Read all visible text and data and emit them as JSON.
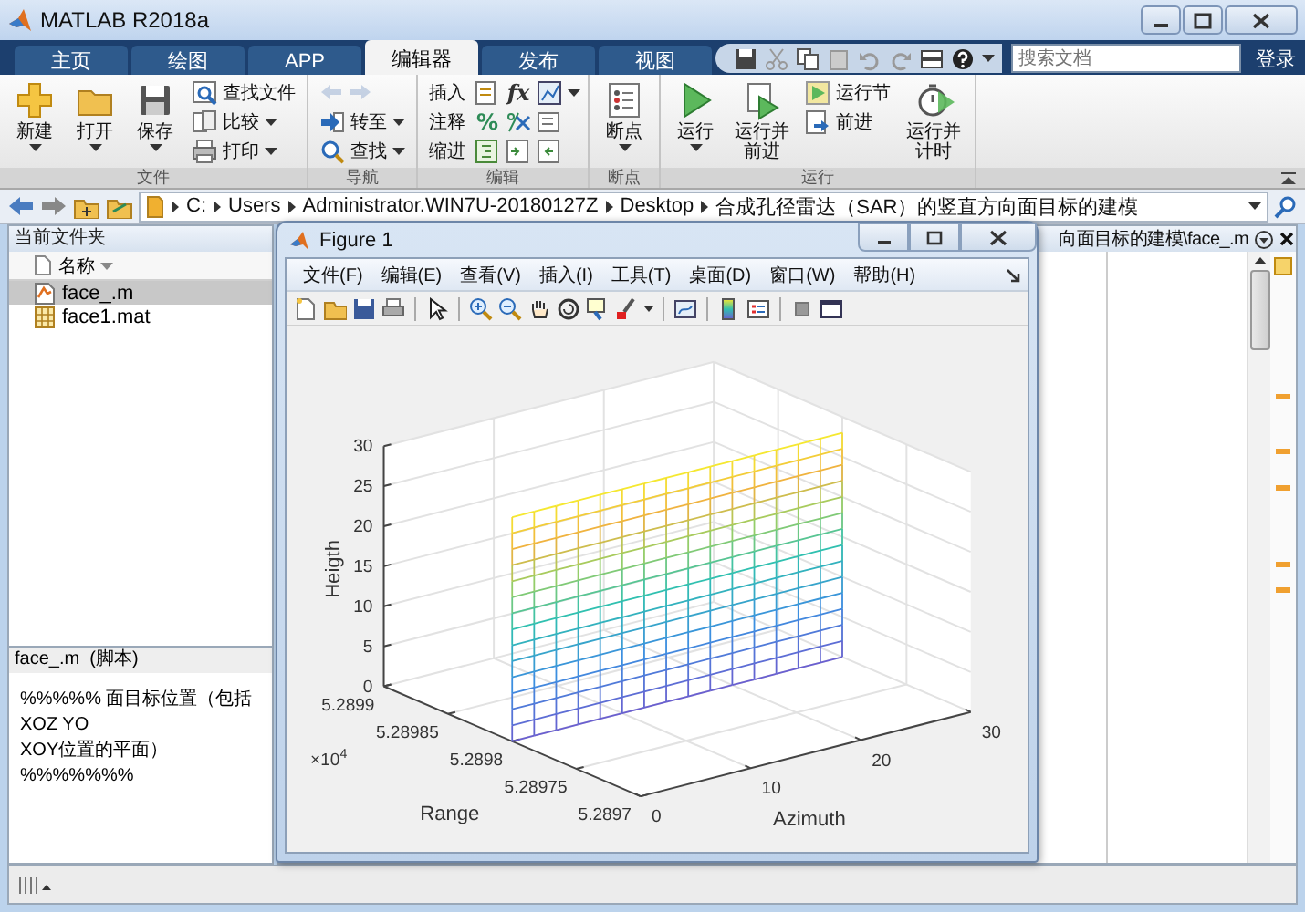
{
  "window": {
    "title": "MATLAB R2018a"
  },
  "tabs": [
    {
      "label": "主页",
      "selected": false
    },
    {
      "label": "绘图",
      "selected": false
    },
    {
      "label": "APP",
      "selected": false
    },
    {
      "label": "编辑器",
      "selected": true
    },
    {
      "label": "发布",
      "selected": false
    },
    {
      "label": "视图",
      "selected": false
    }
  ],
  "search": {
    "placeholder": "搜索文档"
  },
  "sign_in": "登录",
  "ribbon_groups": [
    {
      "title": "文件",
      "items": [
        {
          "kind": "large",
          "label": "新建",
          "has_menu": true
        },
        {
          "kind": "large",
          "label": "打开",
          "has_menu": true
        },
        {
          "kind": "large",
          "label": "保存",
          "has_menu": true
        },
        {
          "kind": "stack",
          "rows": [
            {
              "label": "查找文件",
              "has_menu": false,
              "disabled": false
            },
            {
              "label": "比较",
              "has_menu": true,
              "disabled": false
            },
            {
              "label": "打印",
              "has_menu": true,
              "disabled": false
            }
          ]
        }
      ]
    },
    {
      "title": "导航",
      "items": [
        {
          "kind": "stack",
          "rows": [
            {
              "has_menu": false,
              "disabled": true
            },
            {
              "label": "转至",
              "has_menu": true,
              "disabled": false
            },
            {
              "label": "查找",
              "has_menu": true,
              "disabled": false
            }
          ]
        }
      ]
    },
    {
      "title": "编辑",
      "items": [
        {
          "kind": "tools",
          "rows": [
            {
              "label": "插入",
              "has_menu": true,
              "tools": [
                {
                  "kind": "icon"
                },
                {
                  "kind": "glyph",
                  "text": "fx"
                },
                {
                  "kind": "icon"
                }
              ]
            },
            {
              "label": "注释",
              "has_menu": false,
              "tools": [
                {
                  "kind": "glyph",
                  "text": "%"
                },
                {
                  "kind": "icon"
                },
                {
                  "kind": "icon"
                }
              ]
            },
            {
              "label": "缩进",
              "has_menu": false,
              "tools": [
                {
                  "kind": "icon"
                },
                {
                  "kind": "icon"
                },
                {
                  "kind": "icon"
                }
              ]
            }
          ]
        }
      ]
    },
    {
      "title": "断点",
      "items": [
        {
          "kind": "large",
          "label": "断点",
          "has_menu": true
        }
      ]
    },
    {
      "title": "运行",
      "items": [
        {
          "kind": "large",
          "label": "运行",
          "has_menu": true
        },
        {
          "kind": "large",
          "label": "运行并前进",
          "has_menu": false
        },
        {
          "kind": "stack",
          "rows": [
            {
              "label": "运行节",
              "has_menu": false,
              "disabled": false
            },
            {
              "label": "前进",
              "has_menu": false,
              "disabled": false
            }
          ]
        },
        {
          "kind": "large",
          "label": "运行并计时",
          "has_menu": false
        }
      ]
    }
  ],
  "address": {
    "segments": [
      "C:",
      "Users",
      "Administrator.WIN7U-20180127Z",
      "Desktop",
      "合成孔径雷达（SAR）的竖直方向面目标的建模"
    ]
  },
  "file_panel": {
    "title": "当前文件夹",
    "column": "名称",
    "files": [
      {
        "name": "face_.m",
        "kind": "script",
        "selected": true
      },
      {
        "name": "face1.mat",
        "kind": "data",
        "selected": false
      }
    ],
    "details": {
      "title": "face_.m  (脚本)",
      "lines": [
        "%%%%% 面目标位置（包括XOZ YO",
        "XOY位置的平面） %%%%%%%"
      ]
    }
  },
  "editor": {
    "title": "向面目标的建模\\face_.m"
  },
  "figure": {
    "title": "Figure 1",
    "menus": [
      "文件(F)",
      "编辑(E)",
      "查看(V)",
      "插入(I)",
      "工具(T)",
      "桌面(D)",
      "窗口(W)",
      "帮助(H)"
    ],
    "plot": {
      "zlabel": "Heigth",
      "xlabel": "Azimuth",
      "ylabel": "Range",
      "zticks": [
        "30",
        "25",
        "20",
        "15",
        "10",
        "5",
        "0"
      ],
      "xticks": [
        "0",
        "10",
        "20",
        "30"
      ],
      "yticks": [
        "5.2899",
        "5.28985",
        "5.2898",
        "5.28975",
        "5.2897"
      ],
      "y_multiplier": {
        "base": "×10",
        "power": "4"
      }
    }
  }
}
